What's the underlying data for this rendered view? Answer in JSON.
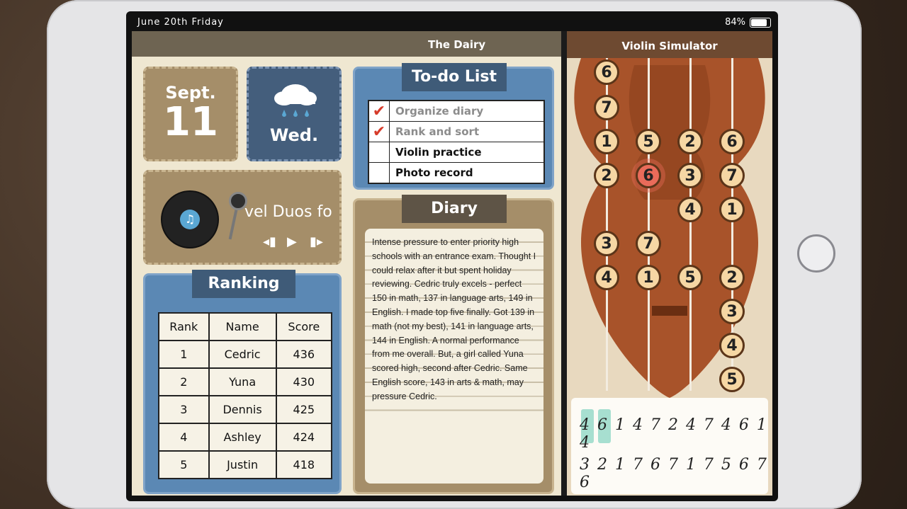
{
  "status": {
    "date": "June 20th Friday",
    "battery": "84%"
  },
  "diary_app": {
    "header": "The Dairy",
    "date_card": {
      "month": "Sept.",
      "day": "11"
    },
    "weather_card": {
      "weekday": "Wed.",
      "icon": "rain-cloud-icon"
    },
    "music": {
      "song": "vel Duos fo",
      "prev": "◂▮",
      "play": "▶",
      "next": "▮▸"
    },
    "todo": {
      "title": "To-do List",
      "items": [
        {
          "label": "Organize diary",
          "done": true
        },
        {
          "label": "Rank and sort",
          "done": true
        },
        {
          "label": "Violin practice",
          "done": false
        },
        {
          "label": "Photo record",
          "done": false
        }
      ]
    },
    "ranking": {
      "title": "Ranking",
      "columns": [
        "Rank",
        "Name",
        "Score"
      ],
      "rows": [
        [
          "1",
          "Cedric",
          "436"
        ],
        [
          "2",
          "Yuna",
          "430"
        ],
        [
          "3",
          "Dennis",
          "425"
        ],
        [
          "4",
          "Ashley",
          "424"
        ],
        [
          "5",
          "Justin",
          "418"
        ]
      ]
    },
    "diary": {
      "title": "Diary",
      "text": "Intense pressure to enter priority high schools with an entrance exam. Thought I could relax after it but spent holiday reviewing. Cedric truly excels - perfect 150 in math, 137 in language arts, 149 in English. I made top five finally. Got 139 in math (not my best), 141 in language arts, 144 in English. A normal performance from me overall. But, a girl called Yuna scored high, second after Cedric. Same English score, 143 in arts & math, may pressure Cedric."
    }
  },
  "violin_app": {
    "header": "Violin Simulator",
    "strings": [
      {
        "notes": [
          "6",
          "7",
          "1",
          "2",
          "3",
          "4"
        ]
      },
      {
        "notes": [
          "5",
          "6",
          "7",
          "1"
        ]
      },
      {
        "notes": [
          "2",
          "3",
          "4",
          "5"
        ]
      },
      {
        "notes": [
          "6",
          "7",
          "1",
          "2",
          "3",
          "4",
          "5"
        ]
      }
    ],
    "sheet": {
      "row1": "4 6 1 4 7 2 4 7 4 6 1 4",
      "row2": "3 2 1 7 6 7 1 7 5 6 7 6"
    }
  }
}
